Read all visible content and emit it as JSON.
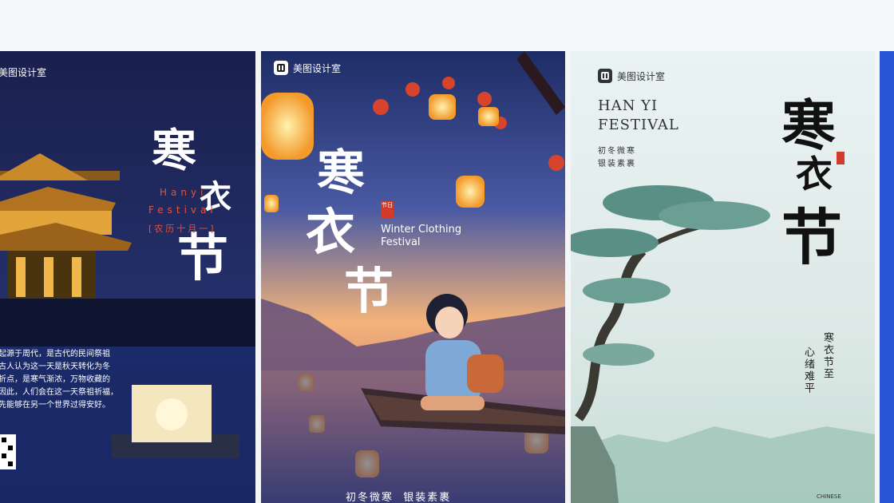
{
  "brand": "美图设计室",
  "cards": [
    {
      "title_chars": [
        "寒",
        "衣",
        "节"
      ],
      "en_line1": "Hanyi",
      "en_line2": "Festival",
      "date_label": "[农历十月一]",
      "body_lines": [
        "起源于周代，是古代的民间祭祖",
        "古人认为这一天是秋天转化为冬",
        "折点，是寒气渐浓，万物收藏的",
        "因此，人们会在这一天祭祖祈福，",
        "先能够在另一个世界过得安好。"
      ]
    },
    {
      "title_chars": [
        "寒",
        "衣",
        "节"
      ],
      "seal": "节日",
      "en_line1": "Winter Clothing",
      "en_line2": "Festival",
      "bottom": "初冬微寒  银装素裹"
    },
    {
      "en_line1": "HAN YI",
      "en_line2": "FESTIVAL",
      "cn_line1": "初冬微寒",
      "cn_line2": "银装素裹",
      "title_chars": [
        "寒",
        "衣",
        "节"
      ],
      "poem_col1": "寒衣节至",
      "poem_col2": "心绪难平",
      "footer": "CHINESE"
    }
  ],
  "colors": {
    "page_bg": "#f4f5f7",
    "card1_bg": "#1b2350",
    "card4_bg": "#2656d6"
  }
}
